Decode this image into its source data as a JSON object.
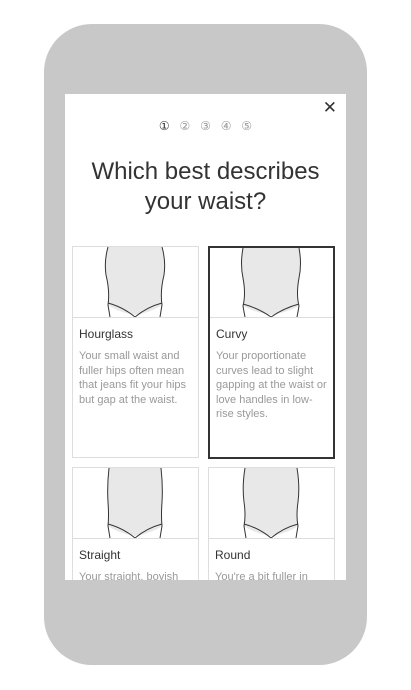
{
  "close_icon": "close-icon",
  "steps": [
    "①",
    "②",
    "③",
    "④",
    "⑤"
  ],
  "title": "Which best describes your waist?",
  "cards": [
    {
      "name": "Hourglass",
      "desc": "Your small waist and fuller hips often mean that jeans fit your hips but gap at the waist.",
      "selected": false
    },
    {
      "name": "Curvy",
      "desc": "Your proportionate curves lead to slight gapping at the waist or love handles in low-rise styles.",
      "selected": true
    },
    {
      "name": "Straight",
      "desc": "Your straight, boyish",
      "selected": false
    },
    {
      "name": "Round",
      "desc": "You're a bit fuller in",
      "selected": false
    }
  ],
  "colors": {
    "phone": "#c8c8c8",
    "body_fill": "#e8e8e8",
    "text": "#333333",
    "muted": "#999999",
    "border": "#dddddd"
  }
}
